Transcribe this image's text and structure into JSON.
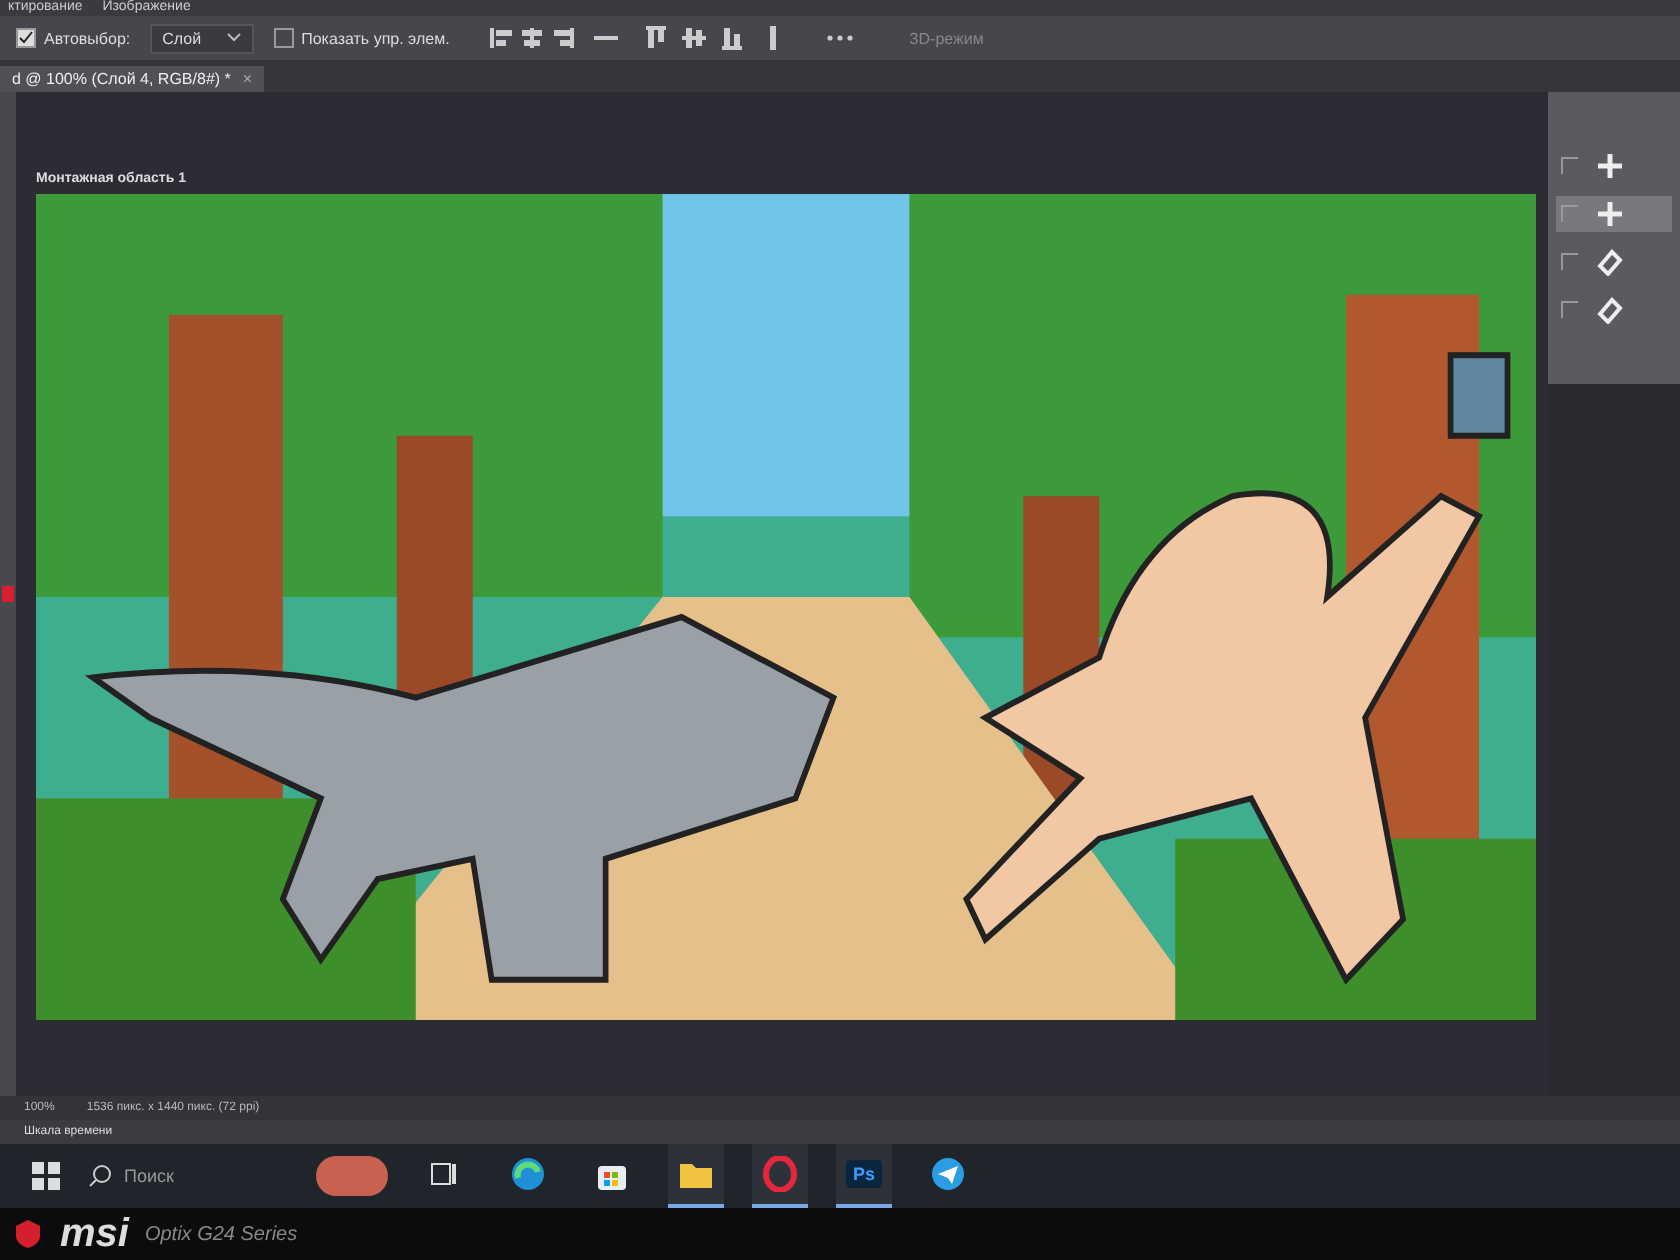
{
  "menu_bar": {
    "items": [
      "ктирование",
      "Изображение"
    ]
  },
  "options_bar": {
    "autoselect": {
      "label": "Автовыбор:",
      "checked": true
    },
    "target_dropdown": {
      "value": "Слой"
    },
    "show_controls": {
      "label": "Показать упр. элем.",
      "checked": false
    },
    "mode_label": "3D-режим"
  },
  "document_tab": {
    "title": "d @ 100% (Слой 4, RGB/8#) *",
    "close": "×"
  },
  "artboard": {
    "label": "Монтажная область 1"
  },
  "status_bar": {
    "zoom": "100%",
    "dimensions": "1536 пикс. x 1440 пикс. (72 ppi)"
  },
  "timeline_panel": {
    "title": "Шкала времени"
  },
  "taskbar": {
    "search_placeholder": "Поиск",
    "apps": [
      {
        "kind": "taskview",
        "active": false
      },
      {
        "kind": "edge",
        "active": false
      },
      {
        "kind": "store",
        "active": false
      },
      {
        "kind": "folder",
        "active": true
      },
      {
        "kind": "opera",
        "active": true
      },
      {
        "kind": "photoshop",
        "label": "Ps",
        "active": true
      },
      {
        "kind": "messenger",
        "active": false
      }
    ]
  },
  "side_panel": {
    "rows": [
      {
        "kind": "move",
        "selected": false
      },
      {
        "kind": "move",
        "selected": true
      },
      {
        "kind": "eraser",
        "selected": false
      },
      {
        "kind": "eraser",
        "selected": false
      }
    ]
  },
  "monitor_bezel": {
    "brand": "msi",
    "model": "Optix G24 Series"
  }
}
